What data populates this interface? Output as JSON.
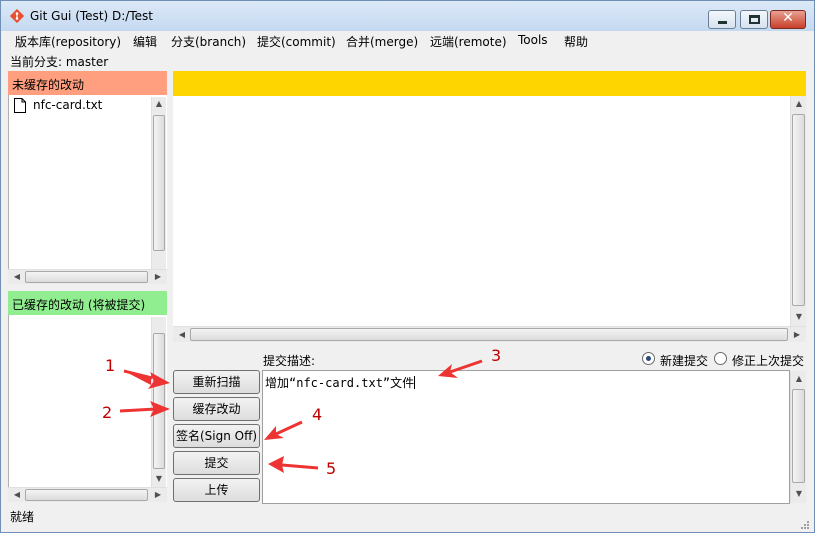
{
  "window": {
    "title": "Git Gui (Test) D:/Test",
    "app_icon": "git-diamond-icon",
    "controls": {
      "minimize_icon": "minimize-icon",
      "maximize_icon": "maximize-icon",
      "close_icon": "close-icon",
      "close_glyph": "✕"
    }
  },
  "menubar": {
    "items": [
      {
        "label": "版本库(repository)"
      },
      {
        "label": "编辑"
      },
      {
        "label": "分支(branch)"
      },
      {
        "label": "提交(commit)"
      },
      {
        "label": "合并(merge)"
      },
      {
        "label": "远端(remote)"
      },
      {
        "label": "Tools"
      },
      {
        "label": "帮助"
      }
    ]
  },
  "branch": {
    "line": "当前分支: master"
  },
  "unstaged": {
    "header": "未缓存的改动",
    "header_color": "#ff9f80",
    "files": [
      {
        "name": "nfc-card.txt",
        "icon": "file-icon"
      }
    ]
  },
  "staged": {
    "header": "已缓存的改动 (将被提交)",
    "header_color": "#90ee90",
    "files": []
  },
  "diff": {
    "header_color": "#ffd500"
  },
  "commit": {
    "label": "提交描述:",
    "message": "增加“nfc-card.txt”文件",
    "mode_new_label": "新建提交",
    "mode_amend_label": "修正上次提交",
    "mode_selected": "new"
  },
  "buttons": {
    "rescan": "重新扫描",
    "stage": "缓存改动",
    "signoff": "签名(Sign Off)",
    "commit": "提交",
    "push": "上传"
  },
  "annotations": {
    "color": "#ee3333",
    "markers": [
      "1",
      "2",
      "3",
      "4",
      "5"
    ]
  },
  "status": {
    "text": "就绪"
  }
}
